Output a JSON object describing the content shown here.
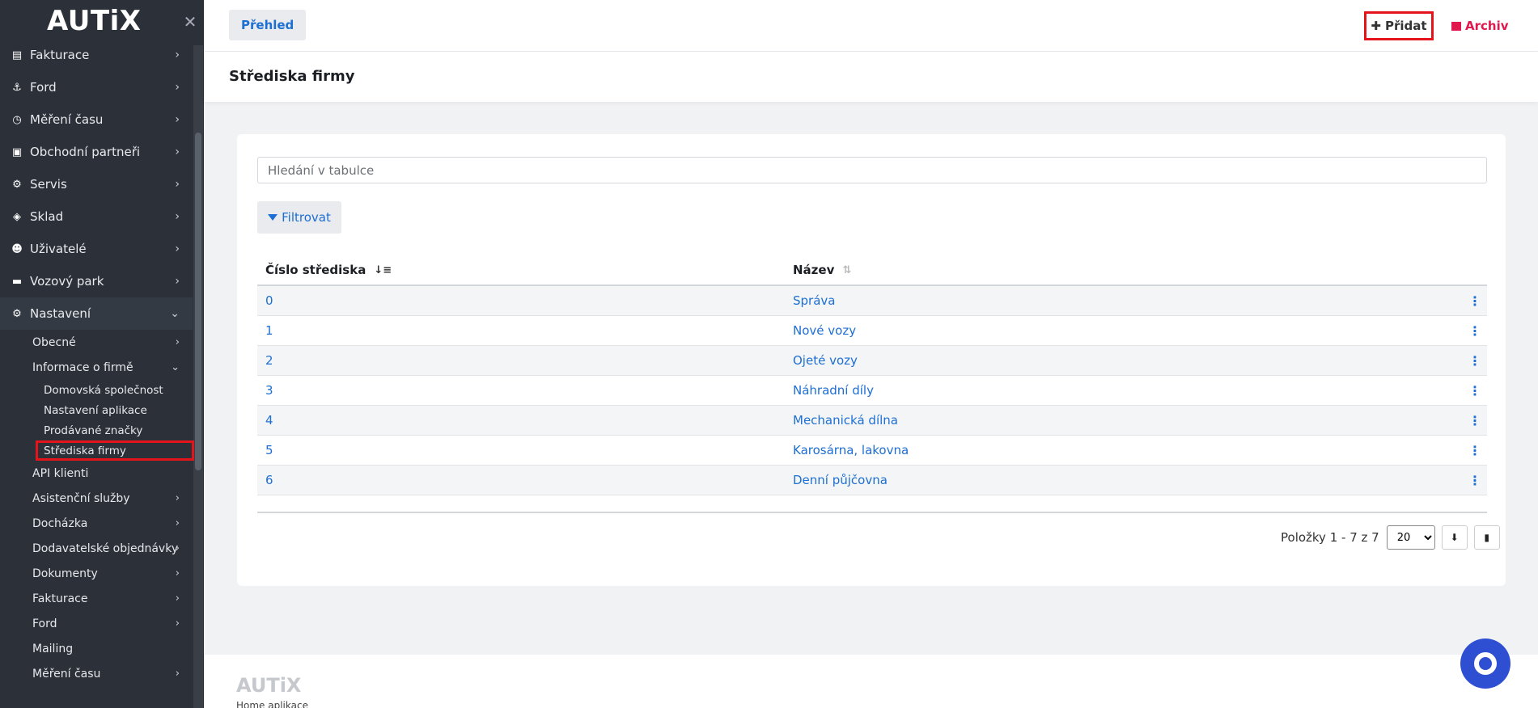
{
  "app": {
    "brand": "AUTiX",
    "footer_brand": "AUTiX",
    "footer_sub": "Home aplikace"
  },
  "sidebar": {
    "items": [
      {
        "label": "Fakturace",
        "icon": "invoice-icon"
      },
      {
        "label": "Ford",
        "icon": "anchor-icon"
      },
      {
        "label": "Měření času",
        "icon": "clock-icon"
      },
      {
        "label": "Obchodní partneři",
        "icon": "bag-icon"
      },
      {
        "label": "Servis",
        "icon": "gears-icon"
      },
      {
        "label": "Sklad",
        "icon": "box-icon"
      },
      {
        "label": "Uživatelé",
        "icon": "users-icon"
      },
      {
        "label": "Vozový park",
        "icon": "car-icon"
      },
      {
        "label": "Nastavení",
        "icon": "gears-icon"
      }
    ],
    "settings_children": {
      "general": "Obecné",
      "company_info": "Informace o firmě",
      "company_children": [
        "Domovská společnost",
        "Nastavení aplikace",
        "Prodávané značky",
        "Střediska firmy"
      ],
      "rest": [
        "API klienti",
        "Asistenční služby",
        "Docházka",
        "Dodavatelské objednávky",
        "Dokumenty",
        "Fakturace",
        "Ford",
        "Mailing",
        "Měření času"
      ]
    }
  },
  "topbar": {
    "overview_tab": "Přehled",
    "add_label": "Přidat",
    "archive_label": "Archiv"
  },
  "page": {
    "title": "Střediska firmy"
  },
  "search": {
    "placeholder": "Hledání v tabulce"
  },
  "filter": {
    "label": "Filtrovat"
  },
  "table": {
    "headers": {
      "number": "Číslo střediska",
      "name": "Název"
    },
    "rows": [
      {
        "number": "0",
        "name": "Správa"
      },
      {
        "number": "1",
        "name": "Nové vozy"
      },
      {
        "number": "2",
        "name": "Ojeté vozy"
      },
      {
        "number": "3",
        "name": "Náhradní díly"
      },
      {
        "number": "4",
        "name": "Mechanická dílna"
      },
      {
        "number": "5",
        "name": "Karosárna, lakovna"
      },
      {
        "number": "6",
        "name": "Denní půjčovna"
      }
    ]
  },
  "pager": {
    "info": "Položky 1 - 7 z 7",
    "page_size": "20"
  },
  "colors": {
    "accent": "#1d6fd3",
    "danger": "#e0184d",
    "highlight": "#e4141b",
    "sidebar": "#2c3139"
  }
}
